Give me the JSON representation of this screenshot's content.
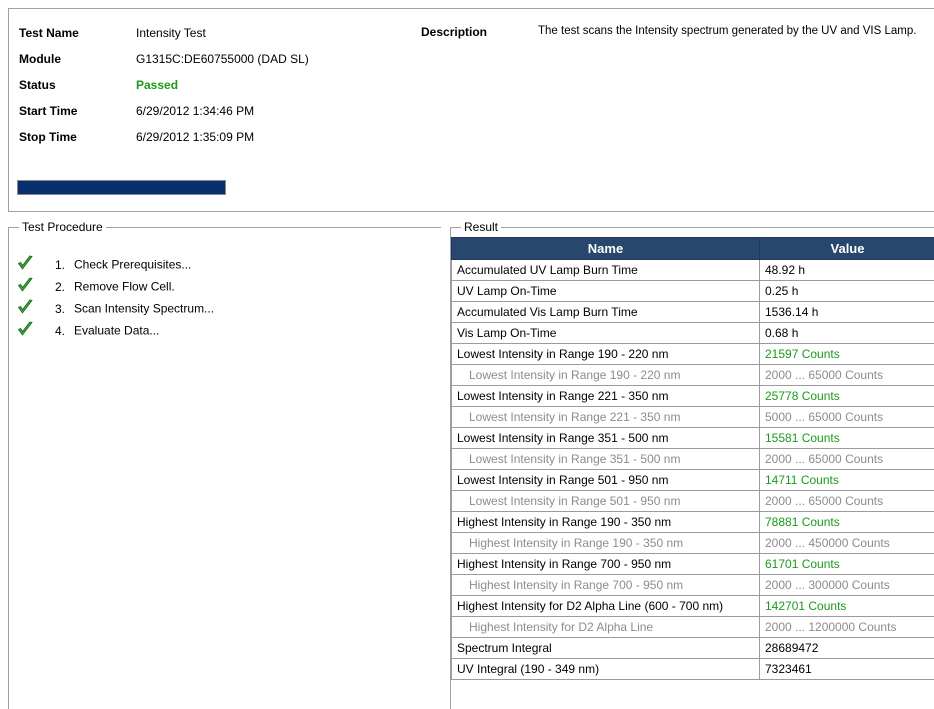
{
  "header": {
    "test_name_label": "Test Name",
    "test_name_value": "Intensity Test",
    "module_label": "Module",
    "module_value": "G1315C:DE60755000 (DAD SL)",
    "status_label": "Status",
    "status_value": "Passed",
    "start_label": "Start Time",
    "start_value": "6/29/2012 1:34:46 PM",
    "stop_label": "Stop Time",
    "stop_value": "6/29/2012 1:35:09 PM",
    "description_label": "Description",
    "description_value": "The test scans the Intensity spectrum generated by the UV and VIS Lamp.",
    "progress": 1.0
  },
  "procedure": {
    "title": "Test Procedure",
    "steps": [
      {
        "num": "1.",
        "label": "Check Prerequisites..."
      },
      {
        "num": "2.",
        "label": "Remove Flow Cell."
      },
      {
        "num": "3.",
        "label": "Scan Intensity Spectrum..."
      },
      {
        "num": "4.",
        "label": "Evaluate Data..."
      }
    ]
  },
  "result": {
    "title": "Result",
    "headers": [
      "Name",
      "Value"
    ],
    "rows": [
      {
        "name": "Accumulated UV Lamp Burn Time",
        "value": "48.92 h",
        "kind": "main"
      },
      {
        "name": "UV Lamp On-Time",
        "value": "0.25 h",
        "kind": "main"
      },
      {
        "name": "Accumulated Vis Lamp Burn Time",
        "value": "1536.14 h",
        "kind": "main"
      },
      {
        "name": "Vis Lamp On-Time",
        "value": "0.68 h",
        "kind": "main"
      },
      {
        "name": "Lowest Intensity in Range 190 - 220 nm",
        "value": "21597 Counts",
        "kind": "pass"
      },
      {
        "name": "Lowest Intensity in Range 190 - 220 nm",
        "value": "2000 ... 65000 Counts",
        "kind": "sub"
      },
      {
        "name": "Lowest Intensity in Range 221 - 350 nm",
        "value": "25778 Counts",
        "kind": "pass"
      },
      {
        "name": "Lowest Intensity in Range 221 - 350 nm",
        "value": "5000 ... 65000 Counts",
        "kind": "sub"
      },
      {
        "name": "Lowest Intensity in Range 351 - 500 nm",
        "value": "15581 Counts",
        "kind": "pass"
      },
      {
        "name": "Lowest Intensity in Range 351 - 500 nm",
        "value": "2000 ... 65000 Counts",
        "kind": "sub"
      },
      {
        "name": "Lowest Intensity in Range 501 - 950 nm",
        "value": "14711 Counts",
        "kind": "pass"
      },
      {
        "name": "Lowest Intensity in Range 501 - 950 nm",
        "value": "2000 ... 65000 Counts",
        "kind": "sub"
      },
      {
        "name": "Highest Intensity in Range 190 - 350 nm",
        "value": "78881 Counts",
        "kind": "pass"
      },
      {
        "name": "Highest Intensity in Range 190 - 350 nm",
        "value": "2000 ... 450000 Counts",
        "kind": "sub"
      },
      {
        "name": "Highest Intensity in Range 700 - 950 nm",
        "value": "61701 Counts",
        "kind": "pass"
      },
      {
        "name": "Highest Intensity in Range 700 - 950 nm",
        "value": "2000 ... 300000 Counts",
        "kind": "sub"
      },
      {
        "name": "Highest Intensity for D2 Alpha Line (600 - 700 nm)",
        "value": "142701 Counts",
        "kind": "pass"
      },
      {
        "name": "Highest Intensity for D2 Alpha Line",
        "value": "2000 ... 1200000 Counts",
        "kind": "sub"
      },
      {
        "name": "Spectrum Integral",
        "value": "28689472",
        "kind": "main"
      },
      {
        "name": "UV Integral (190 - 349 nm)",
        "value": "7323461",
        "kind": "main"
      }
    ]
  },
  "colors": {
    "pass_green": "#1b9a1b",
    "header_bg": "#27476e",
    "progress_fill": "#0a2f6e",
    "sub_gray": "#8c8c8c"
  },
  "icons": {
    "step_status": "check-icon"
  }
}
